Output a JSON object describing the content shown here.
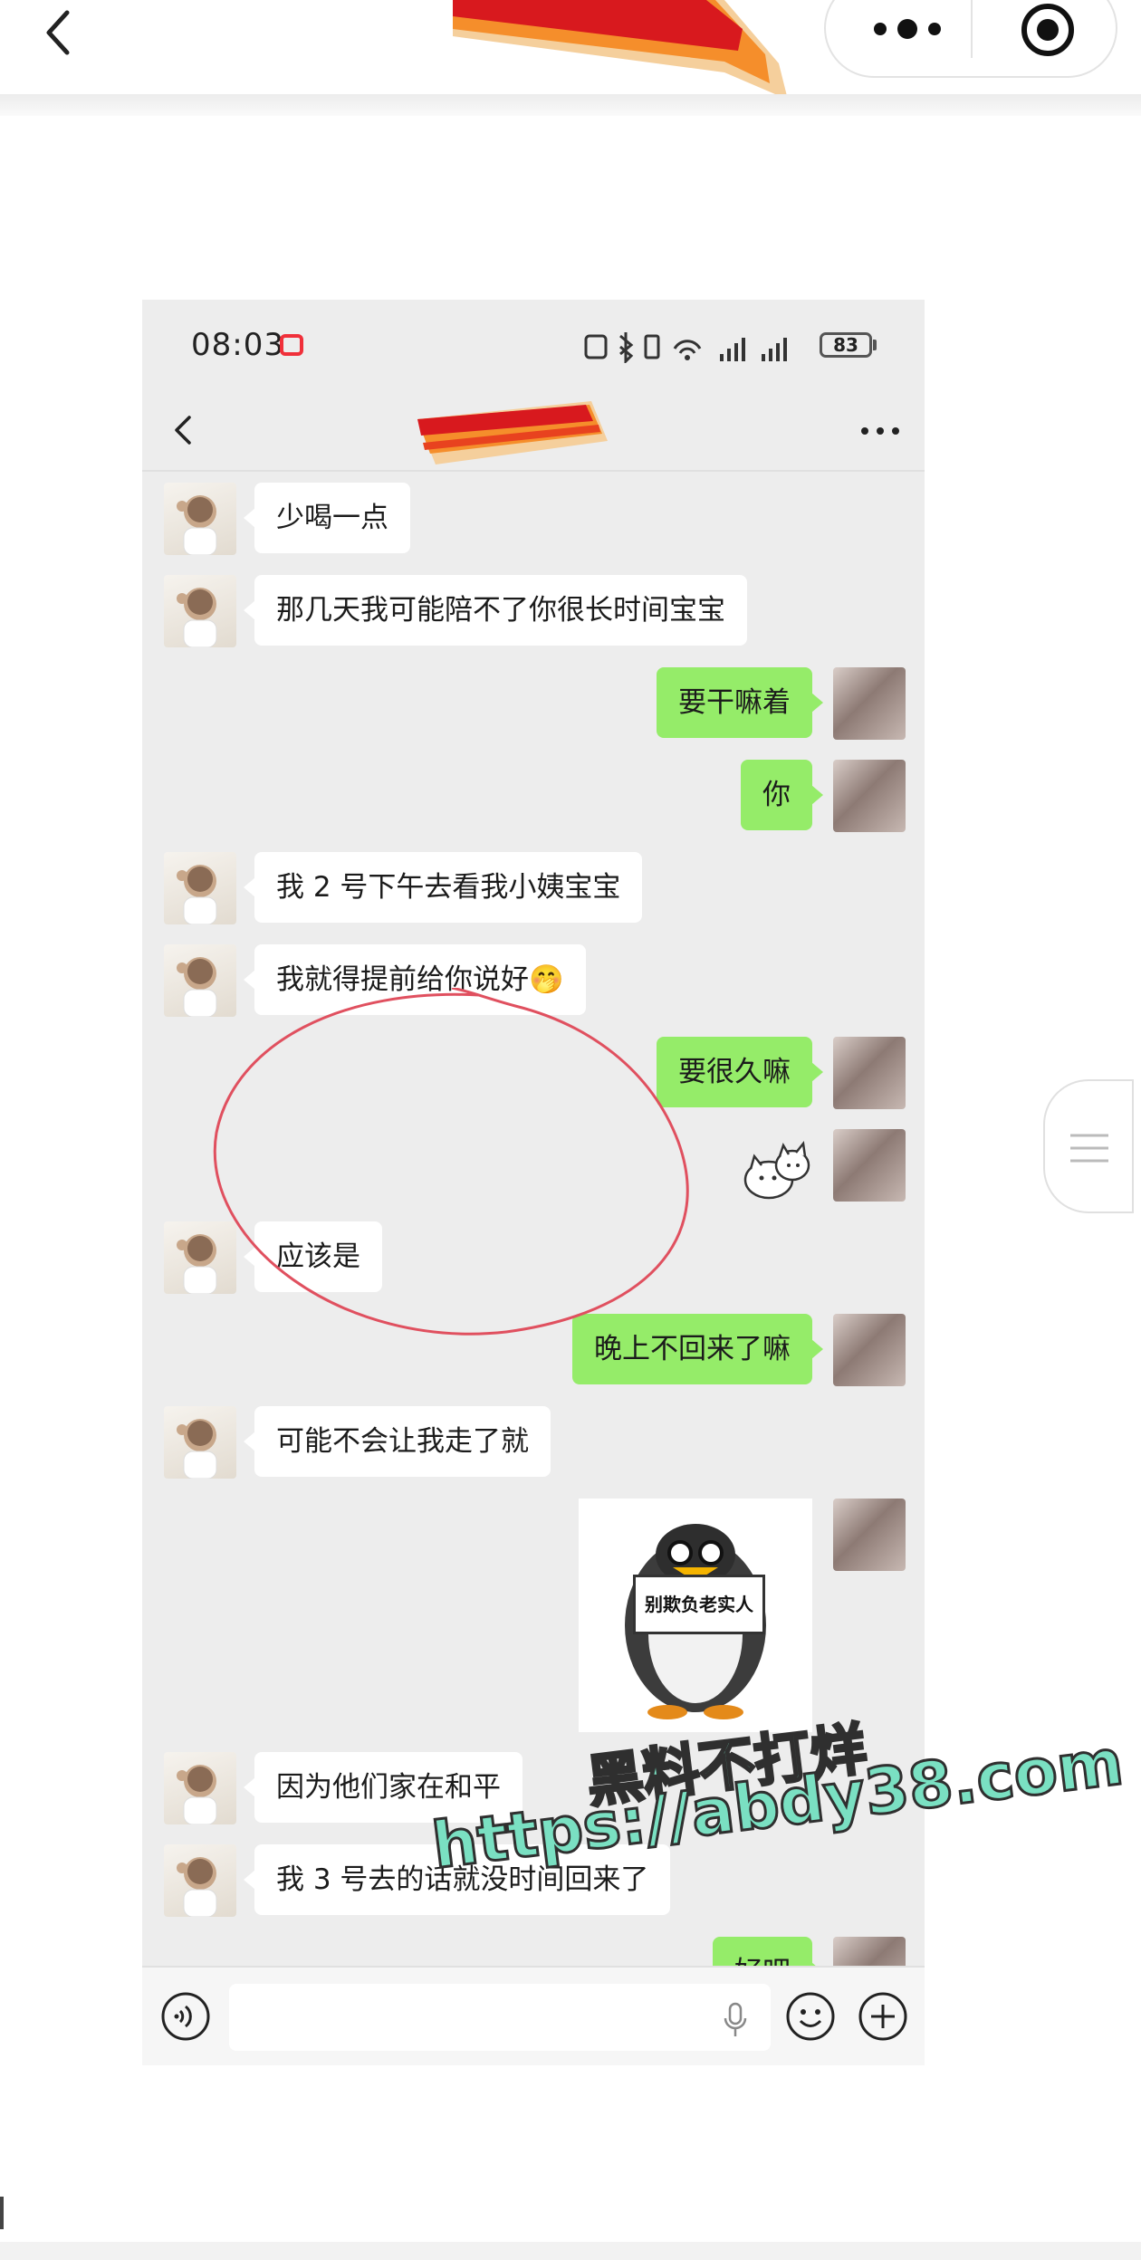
{
  "outer": {
    "title": "",
    "icons": [
      "back-icon",
      "more-dots-icon",
      "close-target-icon"
    ]
  },
  "phone": {
    "status": {
      "time": "08:03",
      "battery": "83"
    },
    "chat_title": "",
    "messages": [
      {
        "side": "in",
        "type": "text",
        "text": "少喝一点"
      },
      {
        "side": "in",
        "type": "text",
        "text": "那几天我可能陪不了你很长时间宝宝"
      },
      {
        "side": "out",
        "type": "text",
        "text": "要干嘛着"
      },
      {
        "side": "out",
        "type": "text",
        "text": "你"
      },
      {
        "side": "in",
        "type": "text",
        "text": "我 2 号下午去看我小姨宝宝"
      },
      {
        "side": "in",
        "type": "text",
        "text": "我就得提前给你说好🤭"
      },
      {
        "side": "out",
        "type": "text",
        "text": "要很久嘛"
      },
      {
        "side": "out",
        "type": "sticker",
        "text": "cat-sticker"
      },
      {
        "side": "in",
        "type": "text",
        "text": "应该是"
      },
      {
        "side": "out",
        "type": "text",
        "text": "晚上不回来了嘛"
      },
      {
        "side": "in",
        "type": "text",
        "text": "可能不会让我走了就"
      },
      {
        "side": "out",
        "type": "image",
        "text": "别欺负老实人"
      },
      {
        "side": "in",
        "type": "text",
        "text": "因为他们家在和平"
      },
      {
        "side": "in",
        "type": "text",
        "text": "我 3 号去的话就没时间回来了"
      },
      {
        "side": "out",
        "type": "text",
        "text": "好吧"
      }
    ],
    "input": {
      "placeholder": ""
    }
  },
  "watermark": {
    "line1": "黑料不打烊",
    "line2": "https://abdy38.com"
  },
  "colors": {
    "bubble_out": "#95ec69",
    "bubble_in": "#ffffff",
    "chat_bg": "#ededed",
    "annotation": "#e0505f",
    "watermark": "#7ae0c2"
  }
}
